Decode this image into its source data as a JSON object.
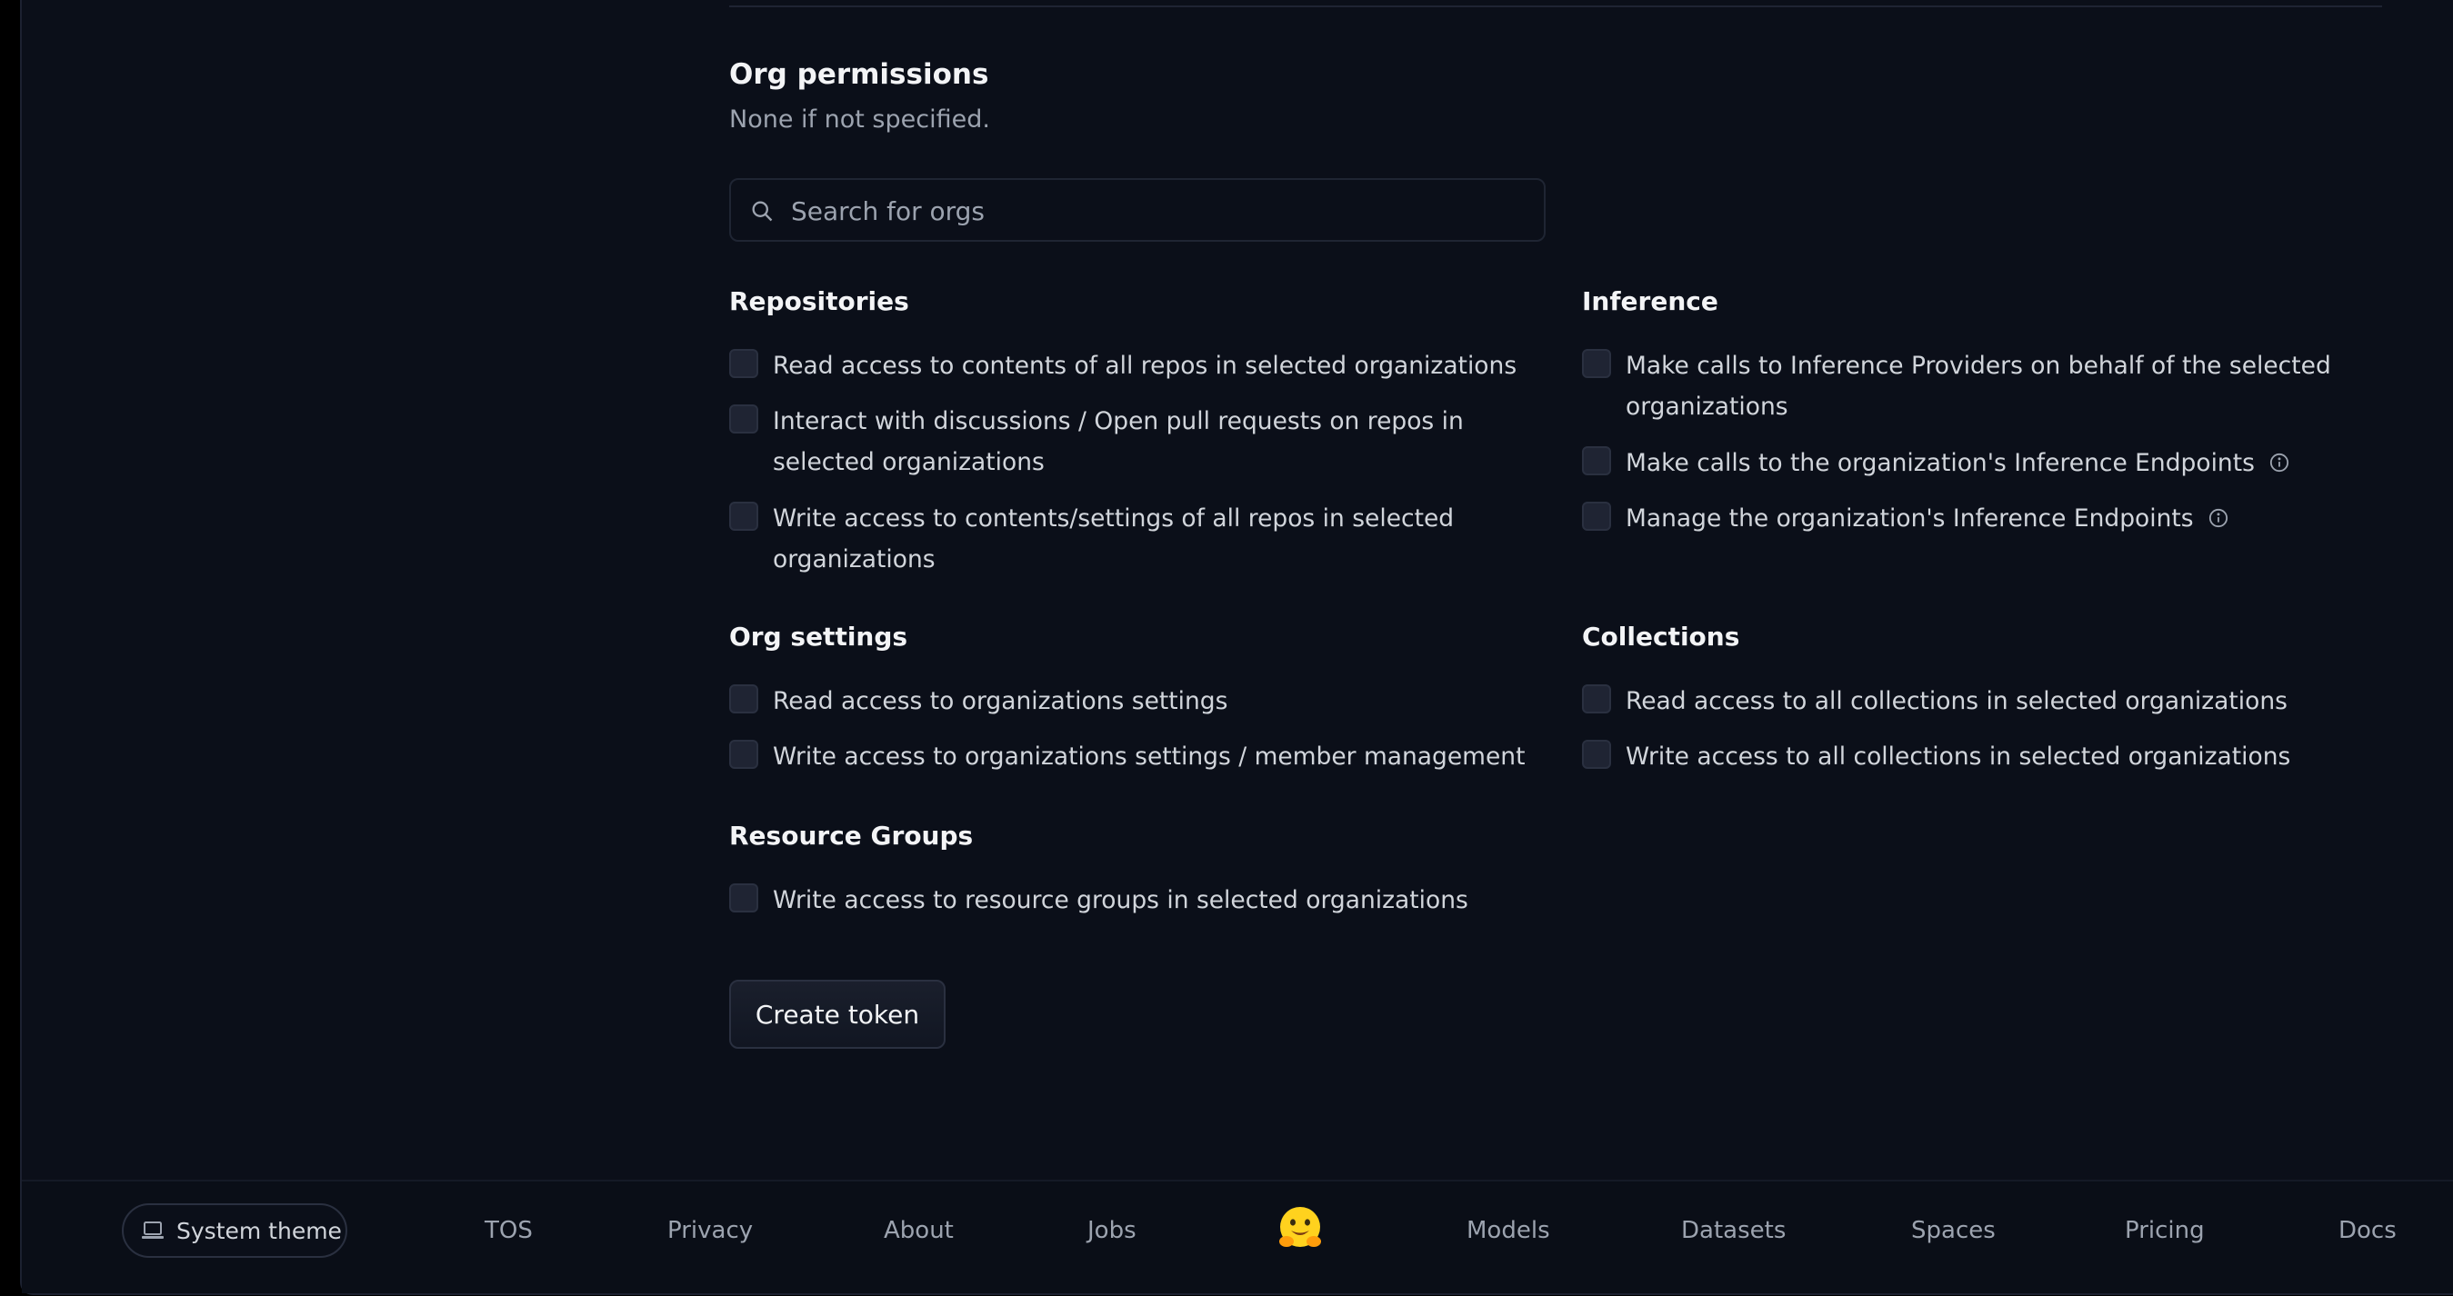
{
  "org_permissions": {
    "title": "Org permissions",
    "subtitle": "None if not specified.",
    "search": {
      "placeholder": "Search for orgs",
      "value": ""
    }
  },
  "groups": {
    "repositories": {
      "title": "Repositories",
      "options": [
        {
          "line1": "Read access to contents of all repos in selected organizations",
          "line2": "",
          "checked": false
        },
        {
          "line1": "Interact with discussions / Open pull requests on repos in",
          "line2": "selected organizations",
          "checked": false
        },
        {
          "line1": "Write access to contents/settings of all repos in selected",
          "line2": "organizations",
          "checked": false
        }
      ]
    },
    "inference": {
      "title": "Inference",
      "options": [
        {
          "line1": "Make calls to Inference Providers on behalf of the selected",
          "line2": "organizations",
          "checked": false
        },
        {
          "line1": "Make calls to the organization's Inference Endpoints",
          "line2": "",
          "checked": false
        },
        {
          "line1": "Manage the organization's Inference Endpoints",
          "line2": "",
          "checked": false
        }
      ]
    },
    "org_settings": {
      "title": "Org settings",
      "options": [
        {
          "line1": "Read access to organizations settings",
          "checked": false
        },
        {
          "line1": "Write access to organizations settings / member management",
          "checked": false
        }
      ]
    },
    "collections": {
      "title": "Collections",
      "options": [
        {
          "line1": "Read access to all collections in selected organizations",
          "checked": false
        },
        {
          "line1": "Write access to all collections in selected organizations",
          "checked": false
        }
      ]
    },
    "resource_groups": {
      "title": "Resource Groups",
      "options": [
        {
          "line1": "Write access to resource groups in selected organizations",
          "checked": false
        }
      ]
    }
  },
  "create_button": "Create token",
  "footer": {
    "theme_label": "System theme",
    "links": [
      "TOS",
      "Privacy",
      "About",
      "Jobs",
      "Models",
      "Datasets",
      "Spaces",
      "Pricing",
      "Docs"
    ]
  },
  "colors": {
    "background": "#0b0f19",
    "checkbox": "#1f2433",
    "text_primary": "#f3f4f6",
    "text_secondary": "#9ca3af"
  }
}
